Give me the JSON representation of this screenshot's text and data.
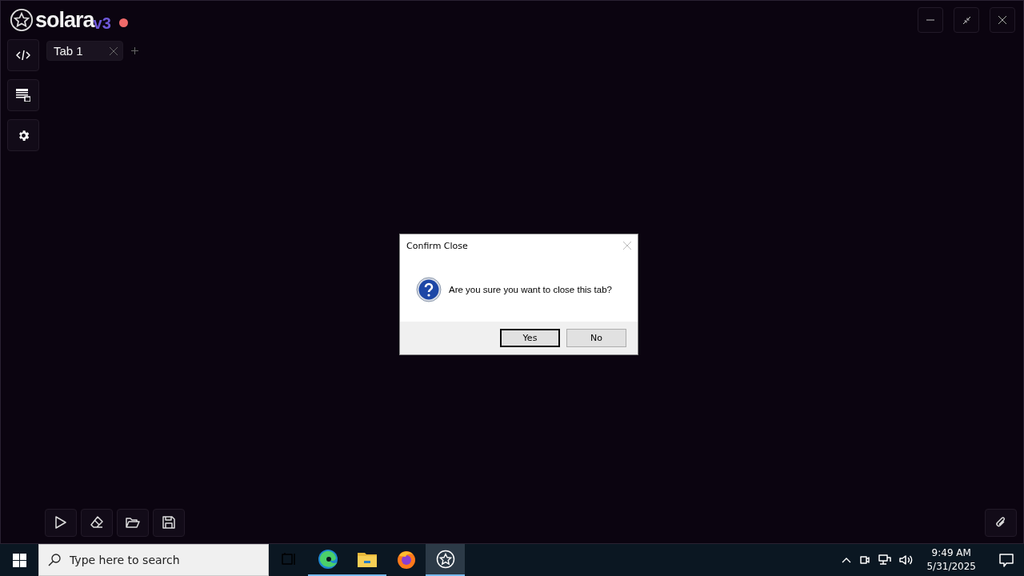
{
  "app": {
    "logo": {
      "name": "solara",
      "version": "v3"
    },
    "tabs": [
      {
        "label": "Tab 1",
        "selected": true
      }
    ],
    "sidebar": [
      {
        "kind": "code"
      },
      {
        "kind": "console"
      },
      {
        "kind": "settings"
      }
    ],
    "toolbar": [
      {
        "kind": "run"
      },
      {
        "kind": "clear"
      },
      {
        "kind": "open"
      },
      {
        "kind": "save"
      }
    ]
  },
  "dialog": {
    "title": "Confirm Close",
    "message": "Are you sure you want to close this tab?",
    "buttons": [
      {
        "label": "Yes",
        "selected": true
      },
      {
        "label": "No",
        "selected": false
      }
    ]
  },
  "taskbar": {
    "search": {
      "placeholder": "Type here to search"
    },
    "apps": [
      {
        "kind": "taskview",
        "running": false,
        "selected": false
      },
      {
        "kind": "edge",
        "running": true,
        "selected": false
      },
      {
        "kind": "explorer",
        "running": true,
        "selected": false
      },
      {
        "kind": "firefox",
        "running": false,
        "selected": false
      },
      {
        "kind": "solara",
        "running": true,
        "selected": true
      }
    ],
    "time": "9:49 AM",
    "date": "5/31/2025"
  }
}
